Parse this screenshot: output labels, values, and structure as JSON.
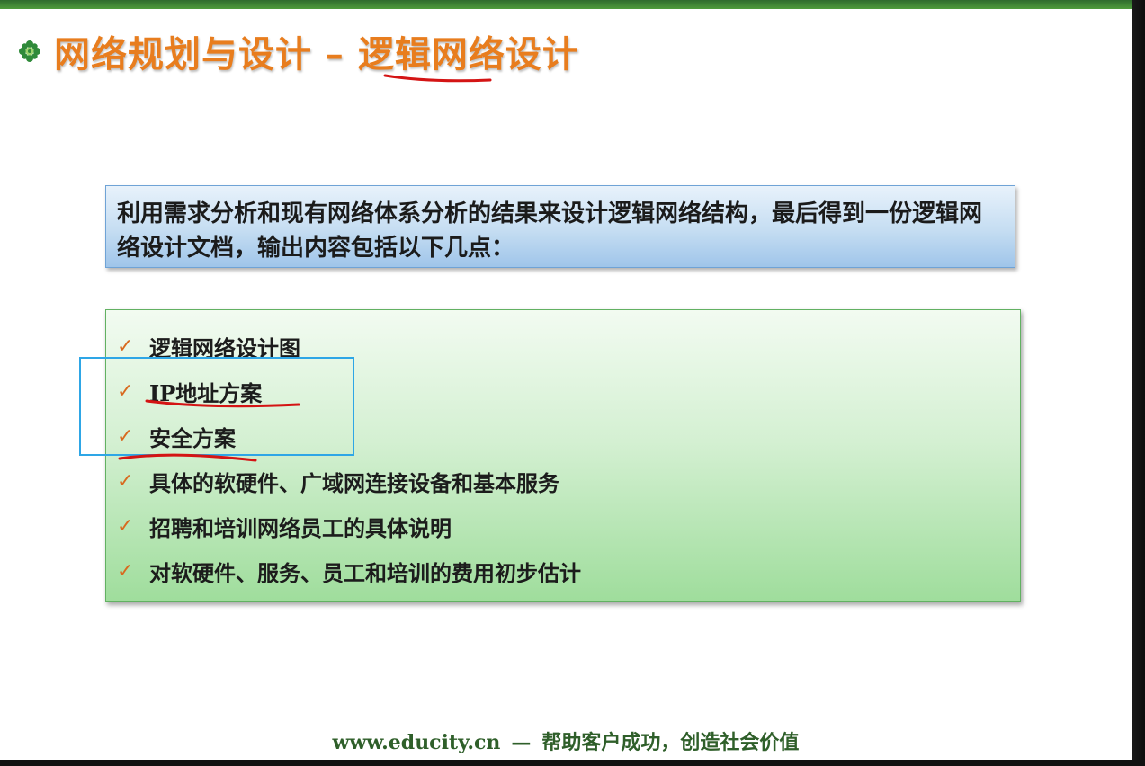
{
  "slide": {
    "title": "网络规划与设计 – 逻辑网络设计",
    "intro_text": "利用需求分析和现有网络体系分析的结果来设计逻辑网络结构，最后得到一份逻辑网络设计文档，输出内容包括以下几点：",
    "items": [
      {
        "label": "逻辑网络设计图"
      },
      {
        "label": "IP地址方案"
      },
      {
        "label": "安全方案"
      },
      {
        "label": "具体的软硬件、广域网连接设备和基本服务"
      },
      {
        "label": "招聘和培训网络员工的具体说明"
      },
      {
        "label": "对软硬件、服务、员工和培训的费用初步估计"
      }
    ],
    "checkmark": "✓",
    "footer": {
      "url": "www.educity.cn",
      "separator": "—",
      "slogan": "帮助客户成功，创造社会价值"
    }
  },
  "colors": {
    "title": "#e87d1e",
    "checkmark": "#d8691e",
    "annotation_red": "#d41414",
    "annotation_blue": "#2ea6e6",
    "footer": "#2f5f2a",
    "intro_box": "#c5ddf2",
    "list_box": "#d4f0d2"
  },
  "icons": {
    "title_bullet": "green-flower-bullet-icon"
  }
}
